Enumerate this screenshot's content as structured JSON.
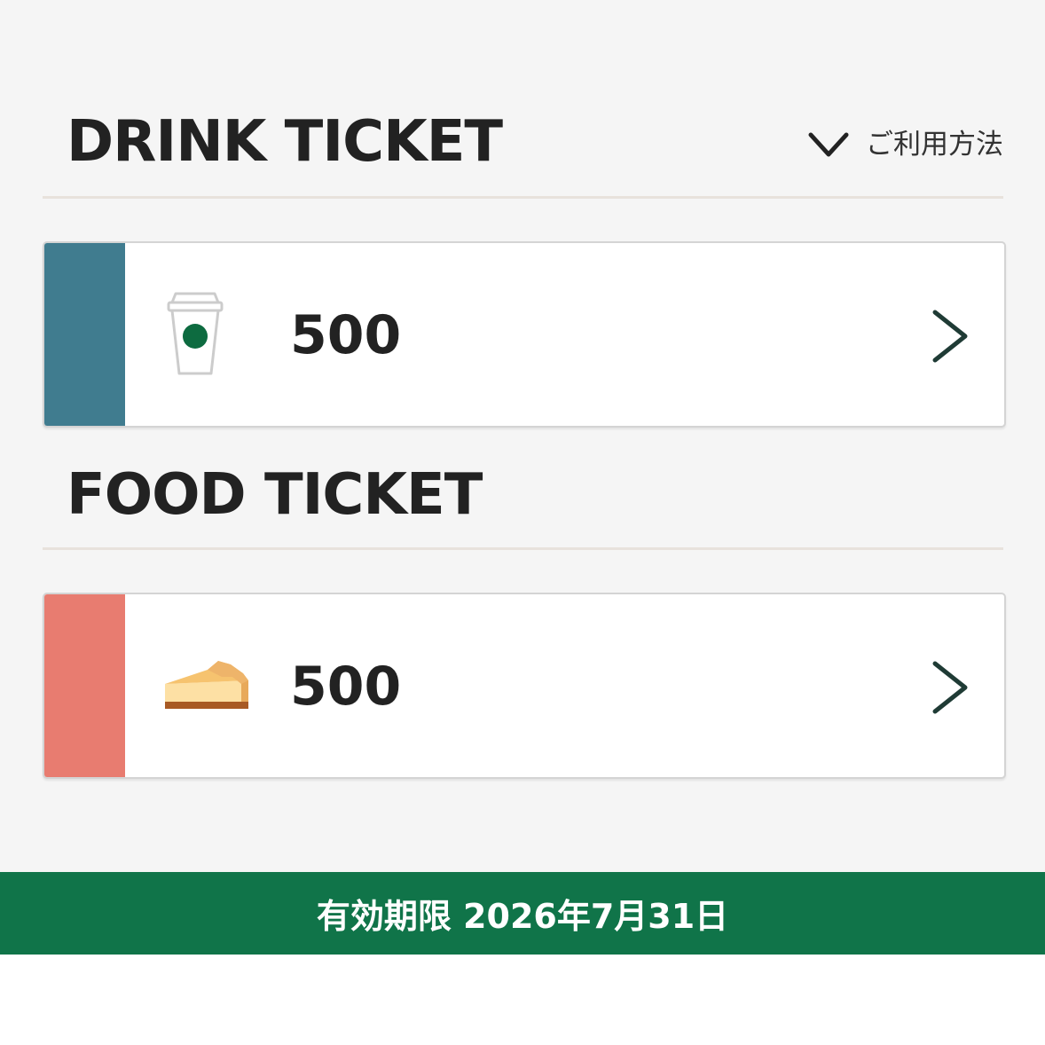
{
  "drink_section": {
    "title": "DRINK TICKET",
    "how_to_label": "ご利用方法",
    "ticket": {
      "amount": "500",
      "stripe_color": "#407c8f",
      "icon": "coffee-cup-icon"
    }
  },
  "food_section": {
    "title": "FOOD TICKET",
    "ticket": {
      "amount": "500",
      "stripe_color": "#e87c70",
      "icon": "cheesecake-icon"
    }
  },
  "footer": {
    "expiry_text": "有効期限 2026年7月31日",
    "background_color": "#107449"
  },
  "colors": {
    "accent_green": "#0d6b40",
    "chevron": "#1f3b35"
  }
}
